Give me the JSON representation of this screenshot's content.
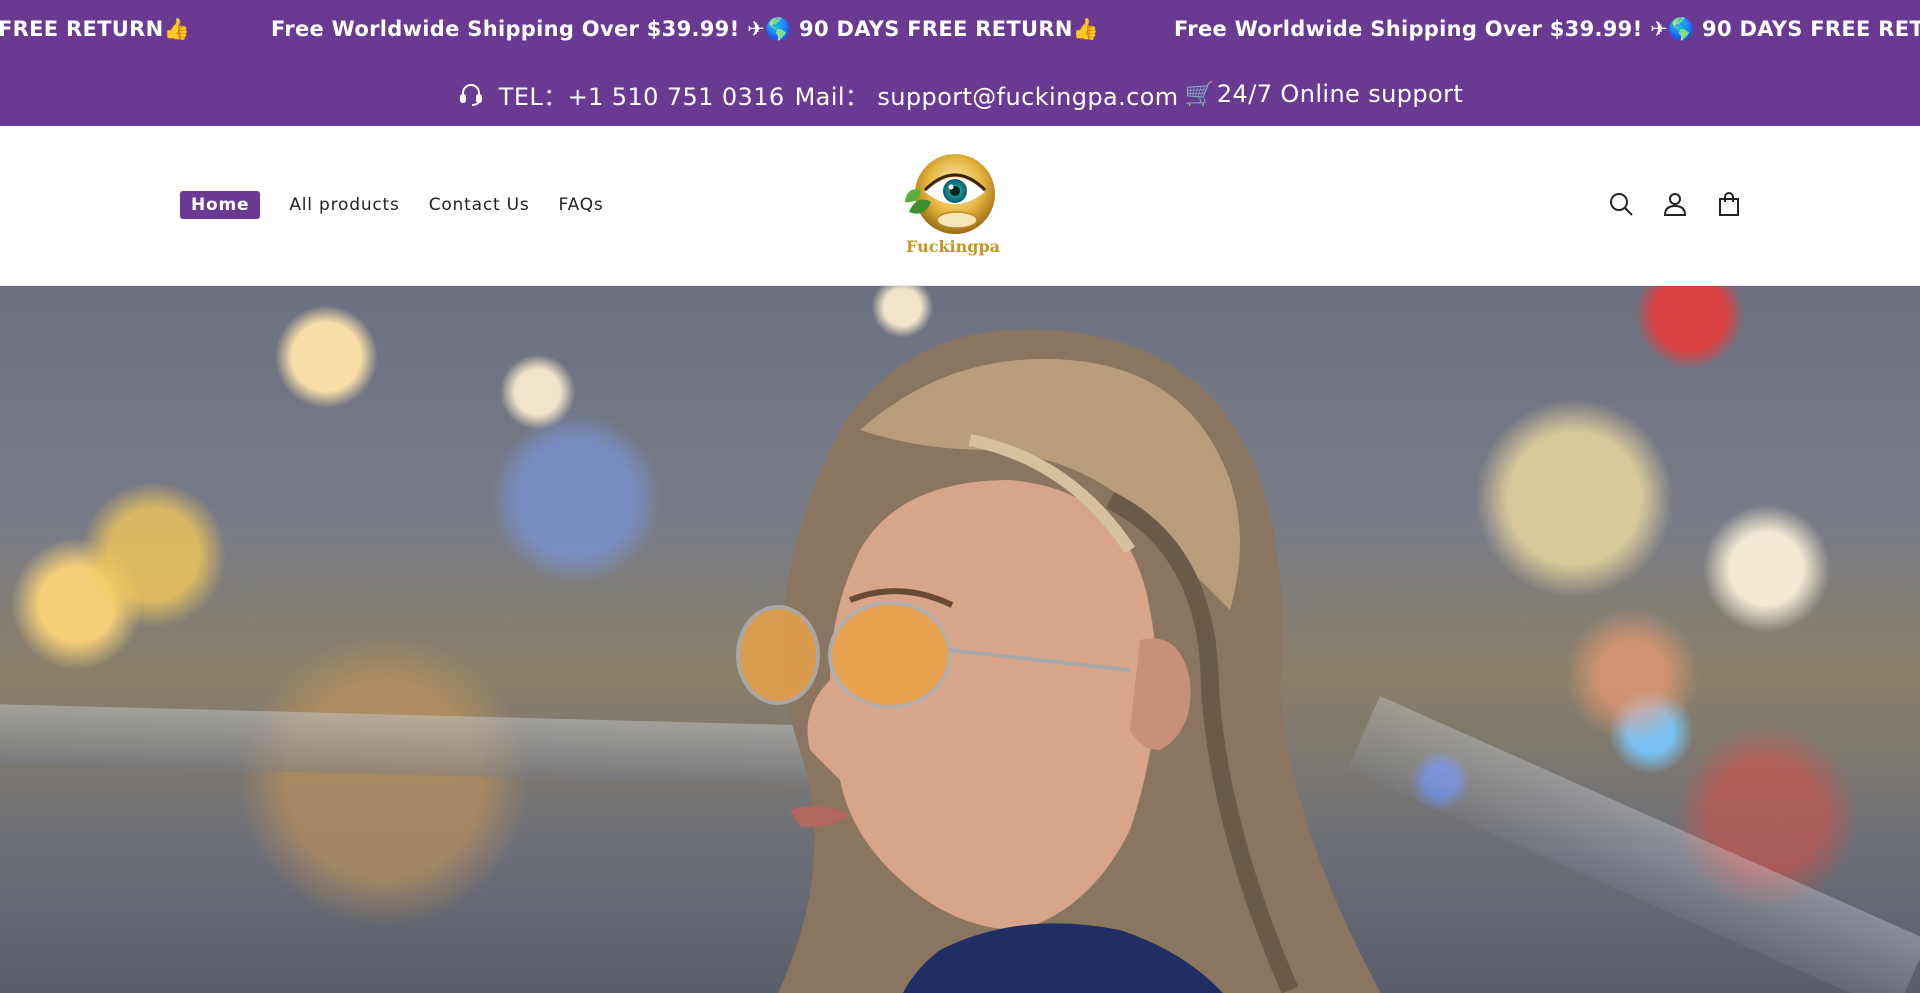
{
  "announcement": {
    "text_partial": "FREE RETURN👍",
    "text": "Free Worldwide Shipping Over $39.99! ✈🌎 90 DAYS FREE RETURN👍",
    "text_cut": "Free Worldwide Shipping Over $39.99! ✈🌎 90 DAYS FREE RETU",
    "background_color": "#6a3a92"
  },
  "contact": {
    "icon": "headset-icon",
    "tel_label": "TEL：+1 510 751 0316",
    "mail_label": "Mail： support@fuckingpa.com",
    "cart_emoji": "🛒",
    "support_label": "24/7 Online support"
  },
  "nav": {
    "items": [
      {
        "label": "Home",
        "active": true
      },
      {
        "label": "All products",
        "active": false
      },
      {
        "label": "Contact Us",
        "active": false
      },
      {
        "label": "FAQs",
        "active": false
      }
    ]
  },
  "logo": {
    "text": "Fuckingpa",
    "icon": "eye-logo-icon"
  },
  "header_icons": [
    "search-icon",
    "account-icon",
    "cart-icon"
  ],
  "colors": {
    "brand_purple": "#6a3a92",
    "text_dark": "#222222",
    "logo_gold": "#c89520"
  },
  "hero": {
    "image": "woman-with-orange-aviator-sunglasses-photo"
  }
}
